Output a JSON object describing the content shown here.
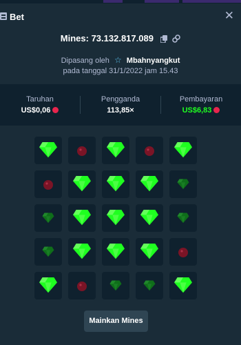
{
  "header": {
    "title": "Bet",
    "icon": "bet-slip-icon",
    "close_icon": "close-icon"
  },
  "bet": {
    "game_label": "Mines: 73.132.817.089",
    "copy_icon": "copy-icon",
    "link_icon": "link-icon",
    "placed_by_label": "Dipasang oleh",
    "user_badge_icon": "star-icon",
    "username": "Mbahnyangkut",
    "date_text": "pada tanggal 31/1/2022 jam 15.43"
  },
  "stats": {
    "wager": {
      "label": "Taruhan",
      "value": "US$0,06",
      "currency_icon": "coin-icon"
    },
    "multiplier": {
      "label": "Pengganda",
      "value": "113,85×"
    },
    "payout": {
      "label": "Pembayaran",
      "value": "US$6,83",
      "currency_icon": "coin-icon"
    }
  },
  "colors": {
    "background": "#1a2c38",
    "panel": "#0f212e",
    "tile": "#0f212e",
    "gem": "#1fff20",
    "gem_dim": "#0f6e1a",
    "mine": "#7a1426",
    "payout_text": "#1fff20",
    "muted_text": "#b1bad3"
  },
  "grid": {
    "rows": [
      [
        "gem",
        "mine",
        "gem",
        "mine",
        "gem"
      ],
      [
        "mine",
        "gem",
        "gem",
        "gem",
        "gem-dim"
      ],
      [
        "gem-dim",
        "gem",
        "gem",
        "gem",
        "gem-dim"
      ],
      [
        "gem-dim",
        "gem",
        "gem",
        "gem",
        "mine"
      ],
      [
        "gem",
        "mine",
        "gem-dim",
        "gem-dim",
        "gem"
      ]
    ]
  },
  "actions": {
    "play_label": "Mainkan Mines"
  }
}
